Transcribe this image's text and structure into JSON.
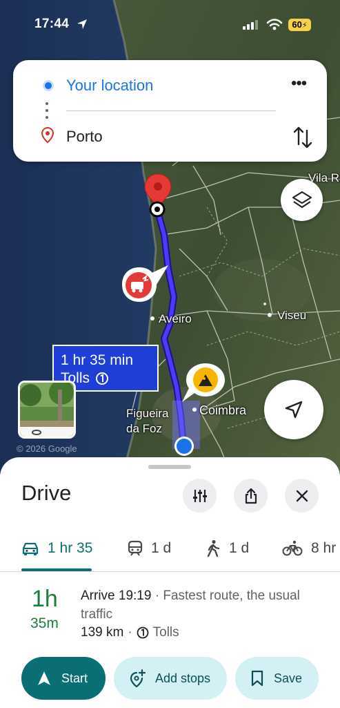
{
  "status_bar": {
    "time": "17:44",
    "battery": "60"
  },
  "directions_card": {
    "origin": "Your location",
    "destination": "Porto",
    "more_label": "•••"
  },
  "map": {
    "labels": {
      "vila_real": "Vila Re",
      "aveiro": "Aveiro",
      "viseu": "Viseu",
      "coimbra": "Coimbra",
      "figueira_1": "Figueira",
      "figueira_2": "da Foz"
    },
    "route_duration": "1 hr 35 min",
    "route_tolls": "Tolls",
    "copyright": "© 2026 Google",
    "route_color": "#3d2bf0"
  },
  "sheet": {
    "title": "Drive",
    "tabs": [
      {
        "label": "1 hr 35",
        "icon": "car-icon",
        "selected": true
      },
      {
        "label": "1 d",
        "icon": "train-icon"
      },
      {
        "label": "1 d",
        "icon": "walk-icon"
      },
      {
        "label": "8 hr",
        "icon": "bike-icon"
      }
    ],
    "eta_hours": "1h",
    "eta_minutes": "35m",
    "arrive_time": "Arrive 19:19",
    "arrive_desc": " · Fastest route, the usual traffic",
    "distance": "139 km",
    "tolls": "Tolls",
    "buttons": {
      "start": "Start",
      "add_stops": "Add stops",
      "save": "Save"
    }
  },
  "colors": {
    "accent": "#0b6e75",
    "eta_green": "#188038",
    "link_blue": "#1a73e8"
  }
}
